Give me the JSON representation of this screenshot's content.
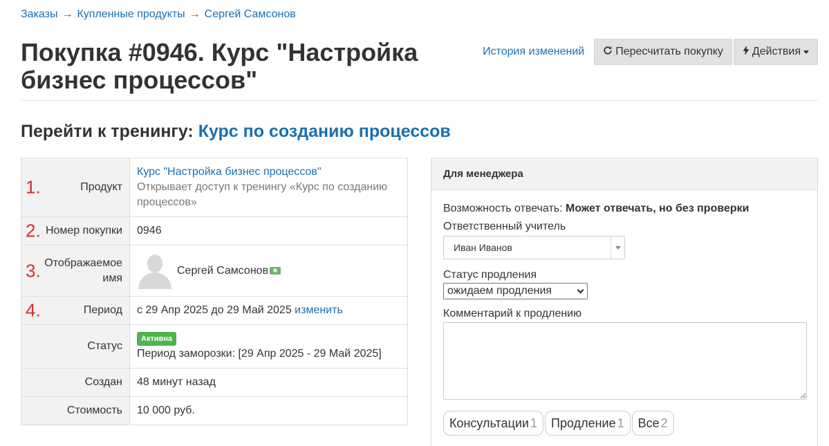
{
  "breadcrumb": {
    "items": [
      "Заказы",
      "Купленные продукты",
      "Сергей Самсонов"
    ],
    "separator": "→"
  },
  "page_title": "Покупка #0946. Курс \"Настройка бизнес процессов\"",
  "header_actions": {
    "history_link": "История изменений",
    "recalc_button": "Пересчитать покупку",
    "actions_button": "Действия",
    "recalc_icon": "refresh-icon",
    "actions_icon": "bolt-icon"
  },
  "training": {
    "prefix": "Перейти к тренингу:",
    "link": "Курс по созданию процессов"
  },
  "info_table": {
    "product": {
      "num": "1.",
      "label": "Продукт",
      "link": "Курс \"Настройка бизнес процессов\"",
      "description": "Открывает доступ к тренингу «Курс по созданию процессов»"
    },
    "purchase_number": {
      "num": "2.",
      "label": "Номер покупки",
      "value": "0946"
    },
    "display_name": {
      "num": "3.",
      "label": "Отображаемое имя",
      "value": "Сергей Самсонов"
    },
    "period": {
      "num": "4.",
      "label": "Период",
      "value": "с 29 Апр 2025 до 29 Май 2025",
      "change_link": "изменить"
    },
    "status": {
      "label": "Статус",
      "badge": "Активна",
      "freeze": "Период заморозки: [29 Апр 2025 - 29 Май 2025]"
    },
    "created": {
      "label": "Создан",
      "value": "48 минут назад"
    },
    "cost": {
      "label": "Стоимость",
      "value": "10 000 руб."
    }
  },
  "manager_panel": {
    "title": "Для менеджера",
    "reply_label": "Возможность отвечать:",
    "reply_value": "Может отвечать, но без проверки",
    "teacher_label": "Ответственный учитель",
    "teacher_value": "Иван Иванов",
    "renewal_label": "Статус продления",
    "renewal_value": "ожидаем продления",
    "comment_label": "Комментарий к продлению",
    "comment_value": "",
    "tabs": [
      {
        "label": "Консультации",
        "count": "1"
      },
      {
        "label": "Продление",
        "count": "1"
      },
      {
        "label": "Все",
        "count": "2"
      }
    ]
  },
  "colors": {
    "link": "#1a6fb0",
    "number_marker": "#d62d2d",
    "badge_active": "#4fb24f"
  }
}
